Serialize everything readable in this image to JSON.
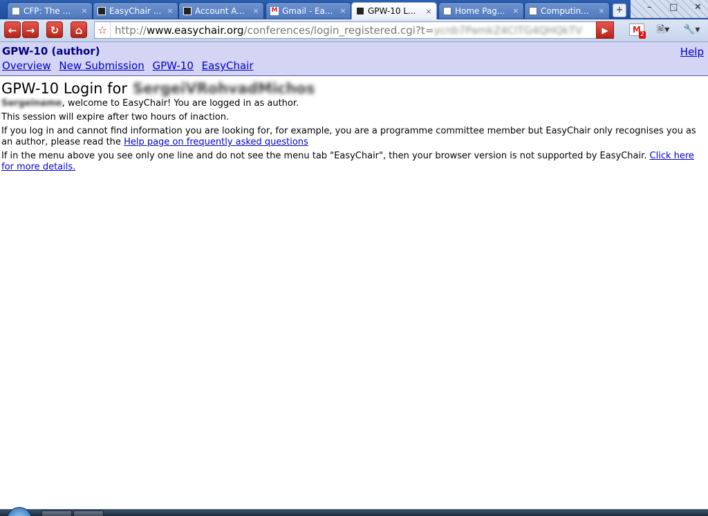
{
  "browser": {
    "tabs": [
      {
        "title": "CFP: The ...",
        "favicon": "doc-icon",
        "active": false
      },
      {
        "title": "EasyChair ...",
        "favicon": "easychair-icon",
        "active": false
      },
      {
        "title": "Account A...",
        "favicon": "easychair-icon",
        "active": false
      },
      {
        "title": "Gmail - Ea...",
        "favicon": "gmail-icon",
        "active": false
      },
      {
        "title": "GPW-10 L...",
        "favicon": "easychair-icon",
        "active": true
      },
      {
        "title": "Home Pag...",
        "favicon": "doc-icon",
        "active": false
      },
      {
        "title": "Computin...",
        "favicon": "doc-icon",
        "active": false
      }
    ],
    "close_glyph": "×",
    "url_prefix": "http://",
    "url_host": "www.easychair.org",
    "url_path": "/conferences/login_registered.cgi?t=",
    "url_tail": "ycnb7PamkZ4CITG4QHQkTV",
    "gmail_badge": "2"
  },
  "header": {
    "conference": "GPW-10 (author)",
    "help": "Help",
    "menu": [
      "Overview",
      "New Submission",
      "GPW-10",
      "EasyChair"
    ]
  },
  "content": {
    "title": "GPW-10 Login for",
    "blurred_user": "SergeiVRohvadMichos",
    "blurred_name": "Sergeiname",
    "welcome": ", welcome to EasyChair! You are logged in as author.",
    "session": "This session will expire after two hours of inaction.",
    "faq_text": "If you log in and cannot find information you are looking for, for example, you are a programme committee member but EasyChair only recognises you as an author, please read the ",
    "faq_link": "Help page on frequently asked questions",
    "browser_text": "If in the menu above you see only one line and do not see the menu tab \"EasyChair\", then your browser version is not supported by EasyChair. ",
    "browser_link": "Click here for more details."
  },
  "colors": {
    "header_bg": "#d4d4f4",
    "conference_title": "#000080",
    "link": "#0000cc"
  }
}
